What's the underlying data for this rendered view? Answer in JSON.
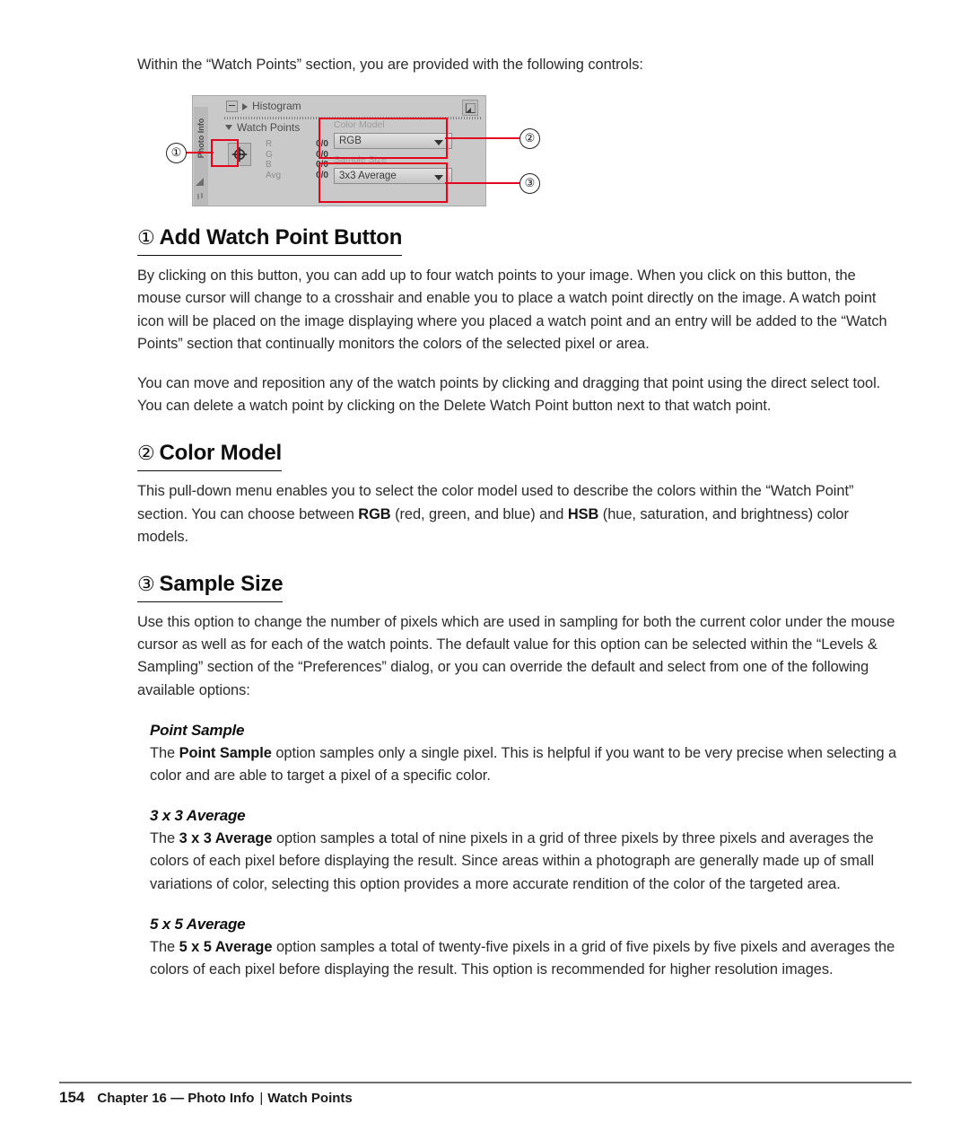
{
  "intro": "Within the “Watch Points” section, you are provided with the following controls:",
  "figure": {
    "panel_tab_label": "Photo Info",
    "histogram_label": "Histogram",
    "watch_points_label": "Watch Points",
    "collapse_button_name": "collapse-button",
    "expand_icon_name": "expand-panel-icon",
    "add_watch_point_icon": "crosshair-target-icon",
    "readout": [
      {
        "channel": "R",
        "value": "0/0"
      },
      {
        "channel": "G",
        "value": "0/0"
      },
      {
        "channel": "B",
        "value": "0/0"
      },
      {
        "channel": "Avg",
        "value": "0/0"
      }
    ],
    "color_model": {
      "label": "Color Model",
      "value": "RGB"
    },
    "sample_size": {
      "label": "Sample Size",
      "value": "3x3 Average"
    },
    "callouts": [
      {
        "marker": "①"
      },
      {
        "marker": "②"
      },
      {
        "marker": "③"
      }
    ],
    "highlight_color": "#e2071f"
  },
  "sections": [
    {
      "marker": "①",
      "title": "Add Watch Point Button",
      "paragraphs": [
        "By clicking on this button, you can add up to four watch points to your image. When you click on this button, the mouse cursor will change to a crosshair and enable you to place a watch point directly on the image. A watch point icon will be placed on the image displaying where you placed a watch point and an entry will be added to the “Watch Points” section that continually monitors the colors of the selected pixel or area.",
        "You can move and reposition any of the watch points by clicking and dragging that point using the direct select tool. You can delete a watch point by clicking on the Delete Watch Point button next to that watch point."
      ]
    },
    {
      "marker": "②",
      "title": "Color Model",
      "paragraph_parts": [
        {
          "text": "This pull-down menu enables you to select the color model used to describe the colors within the “Watch Point” section. You can choose between ",
          "bold": false
        },
        {
          "text": "RGB",
          "bold": true
        },
        {
          "text": " (red, green, and blue) and ",
          "bold": false
        },
        {
          "text": "HSB",
          "bold": true
        },
        {
          "text": " (hue, saturation, and brightness) color models.",
          "bold": false
        }
      ]
    },
    {
      "marker": "③",
      "title": "Sample Size",
      "paragraphs": [
        "Use this option to change the number of pixels which are used in sampling for both the current color under the mouse cursor as well as for each of the watch points. The default value for this option can be selected within the “Levels & Sampling” section of the “Preferences” dialog, or you can override the default and select from one of the following available options:"
      ]
    }
  ],
  "options": [
    {
      "title": "Point Sample",
      "parts": [
        {
          "text": "The ",
          "bold": false
        },
        {
          "text": "Point Sample",
          "bold": true
        },
        {
          "text": " option samples only a single pixel. This is helpful if you want to be very precise when selecting a color and are able to target a pixel of a specific color.",
          "bold": false
        }
      ]
    },
    {
      "title": "3 x 3 Average",
      "parts": [
        {
          "text": "The ",
          "bold": false
        },
        {
          "text": "3 x 3 Average",
          "bold": true
        },
        {
          "text": " option samples a total of nine pixels in a grid of three pixels by three pixels and averages the colors of each pixel before displaying the result. Since areas within a photograph are generally made up of small variations of color, selecting this option provides a more accurate rendition of the color of the targeted area.",
          "bold": false
        }
      ]
    },
    {
      "title": "5 x 5 Average",
      "parts": [
        {
          "text": "The ",
          "bold": false
        },
        {
          "text": "5 x 5 Average",
          "bold": true
        },
        {
          "text": " option samples a total of twenty-five pixels in a grid of five pixels by five pixels and averages the colors of each pixel before displaying the result. This option is recommended for higher resolution images.",
          "bold": false
        }
      ]
    }
  ],
  "footer": {
    "page_number": "154",
    "chapter": "Chapter 16 — Photo Info",
    "separator": "|",
    "topic": "Watch Points"
  }
}
